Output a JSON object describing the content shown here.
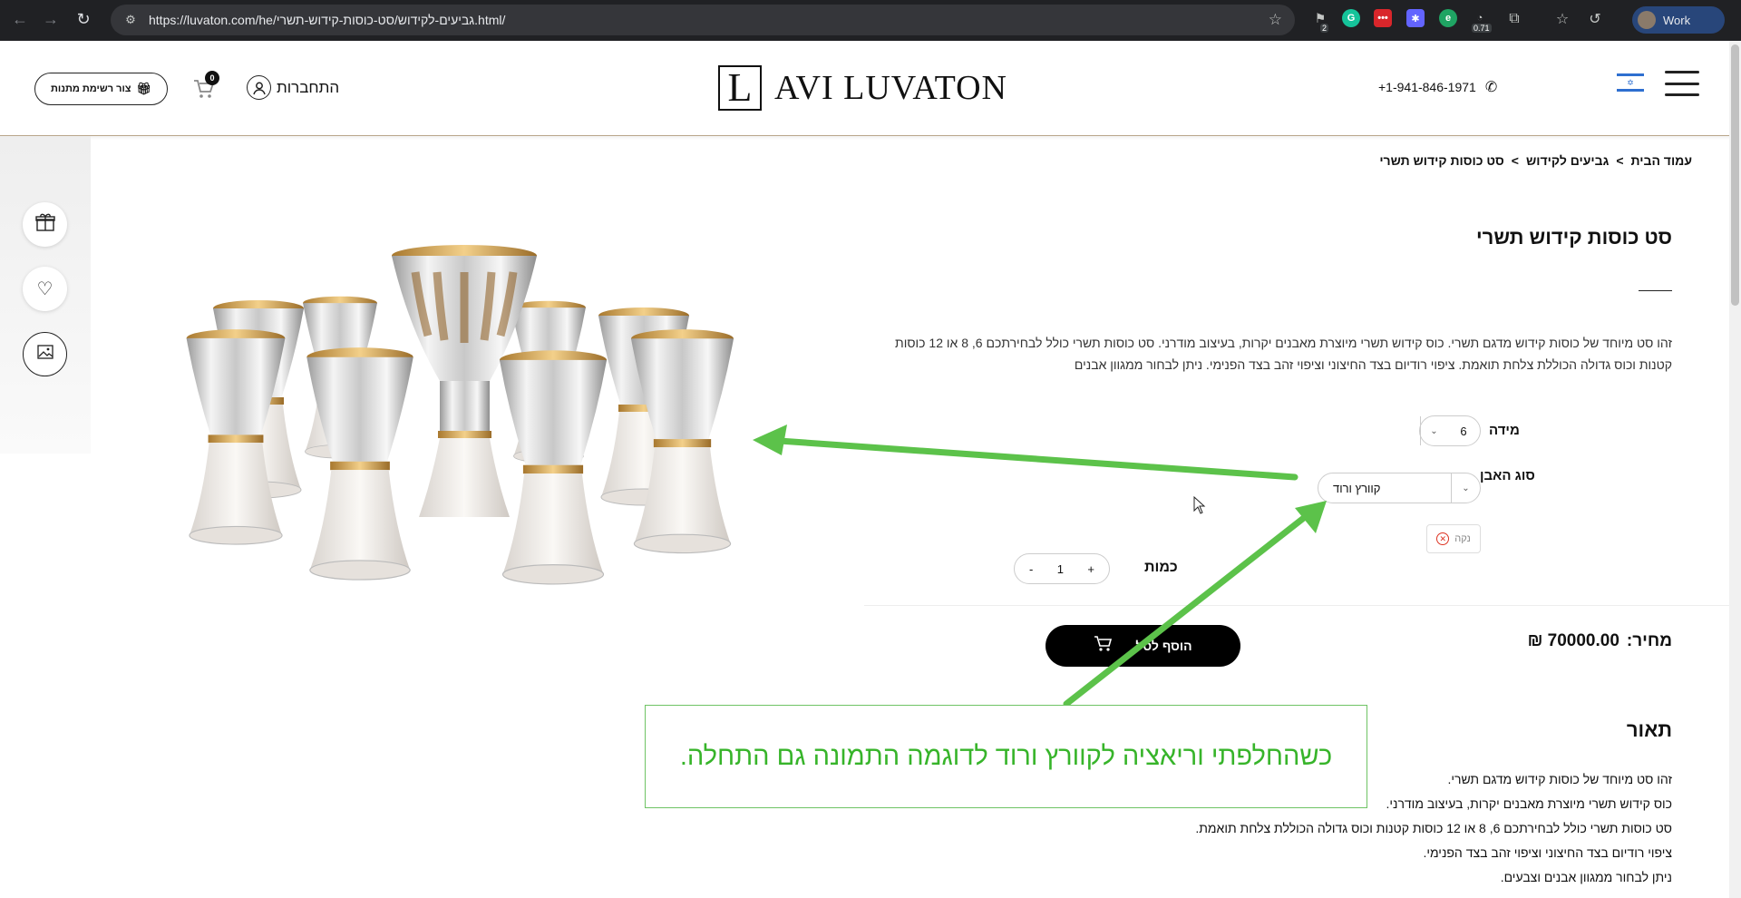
{
  "browser": {
    "url": "https://luvaton.com/he/גביעים-לקידוש/סט-כוסות-קידוש-תשרי.html/",
    "back_icon": "←",
    "forward_icon": "→",
    "reload_icon": "↻",
    "extension_badge_count": "2",
    "extension_badge_value": "0.71",
    "profile_label": "Work"
  },
  "header": {
    "gift_list_label": "צור רשימת מתנות",
    "cart_count": "0",
    "login_label": "התחברות",
    "logo_mark": "L",
    "logo_name": "AVI LUVATON",
    "phone": "+1-941-846-1971"
  },
  "breadcrumb": {
    "home": "עמוד הבית",
    "sep1": ">",
    "category": "גביעים לקידוש",
    "sep2": ">",
    "current": "סט כוסות קידוש תשרי"
  },
  "product": {
    "title": "סט כוסות קידוש תשרי",
    "short_description": "זהו סט מיוחד של כוסות קידוש מדגם תשרי. כוס קידוש תשרי מיוצרת מאבנים יקרות,  בעיצוב מודרני. סט כוסות תשרי כולל לבחירתכם 6, 8 או 12 כוסות קטנות וכוס גדולה הכוללת צלחת תואמת. ציפוי רודיום בצד החיצוני וציפוי זהב בצד הפנימי. ניתן לבחור ממגוון אבנים",
    "size_label": "מידה",
    "size_value": "6",
    "stone_label": "סוג האבן",
    "stone_value": "קוורץ ורוד",
    "clear_label": "נקה",
    "quantity_label": "כמות",
    "quantity_value": "1",
    "qty_minus": "-",
    "qty_plus": "+",
    "price_label": "מחיר:",
    "price_value": "70000.00 ₪",
    "add_to_cart_label": "הוסף לסל",
    "description_title": "תאור",
    "description_lines": [
      "זהו סט מיוחד של כוסות קידוש מדגם תשרי.",
      "כוס קידוש תשרי מיוצרת מאבנים יקרות,  בעיצוב מודרני.",
      "סט כוסות תשרי כולל לבחירתכם 6, 8 או 12 כוסות קטנות וכוס גדולה הכוללת צלחת תואמת.",
      "ציפוי רודיום בצד החיצוני וציפוי זהב בצד הפנימי.",
      "ניתן לבחור ממגוון אבנים וצבעים."
    ]
  },
  "annotation": {
    "text": "כשהחלפתי וריאציה לקוורץ ורוד לדוגמה התמונה גם התחלה.",
    "color": "#37b42a"
  },
  "colors": {
    "chrome_bg": "#202124",
    "accent_green": "#5cc24a",
    "header_border": "#b9a68a"
  }
}
